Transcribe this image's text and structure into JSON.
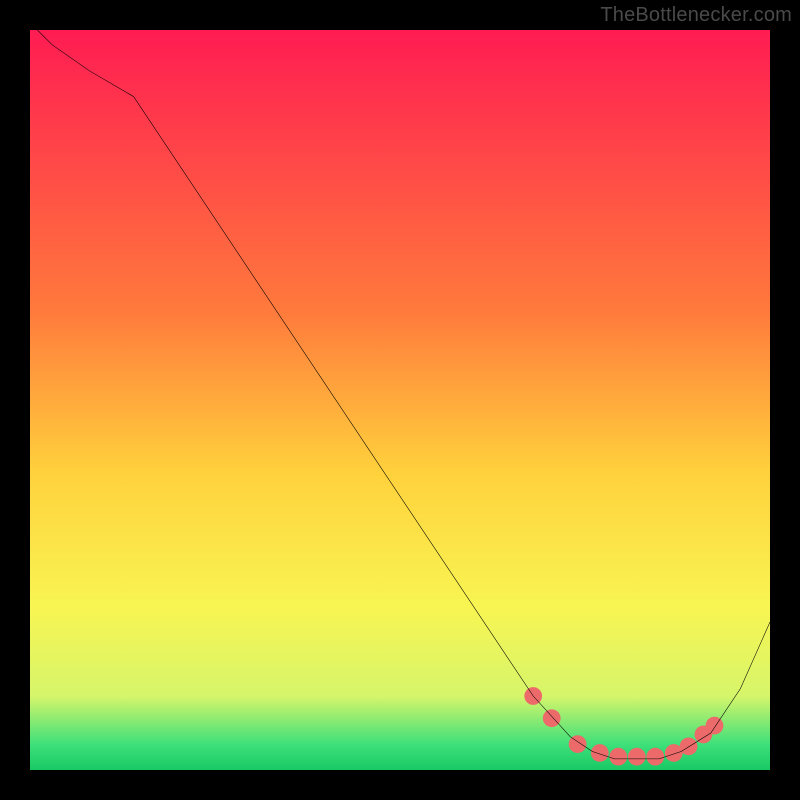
{
  "watermark": "TheBottlenecker.com",
  "chart_data": {
    "type": "line",
    "title": "",
    "xlabel": "",
    "ylabel": "",
    "xlim": [
      0,
      100
    ],
    "ylim": [
      0,
      100
    ],
    "background": {
      "type": "vertical-gradient",
      "stops": [
        {
          "offset": 0.0,
          "color": "#ff1c52"
        },
        {
          "offset": 0.38,
          "color": "#ff7a3c"
        },
        {
          "offset": 0.6,
          "color": "#ffd23c"
        },
        {
          "offset": 0.78,
          "color": "#f8f552"
        },
        {
          "offset": 0.9,
          "color": "#d6f56a"
        },
        {
          "offset": 0.965,
          "color": "#3fe07a"
        },
        {
          "offset": 1.0,
          "color": "#18c964"
        }
      ]
    },
    "series": [
      {
        "name": "bottleneck-curve",
        "color": "#000000",
        "x": [
          1,
          3,
          8,
          14,
          68,
          73,
          76,
          79,
          82,
          85,
          88,
          92,
          96,
          100
        ],
        "y": [
          100,
          98,
          94.5,
          91,
          10,
          4.5,
          2.5,
          1.5,
          1.5,
          1.5,
          2.5,
          5,
          11,
          20
        ]
      }
    ],
    "markers": {
      "name": "highlight-dots",
      "color": "#ec6a6a",
      "radius": 1.2,
      "x": [
        68,
        70.5,
        74,
        77,
        79.5,
        82,
        84.5,
        87,
        89,
        91,
        92.5
      ],
      "y": [
        10,
        7,
        3.5,
        2.3,
        1.8,
        1.8,
        1.8,
        2.3,
        3.2,
        4.8,
        6
      ]
    }
  }
}
